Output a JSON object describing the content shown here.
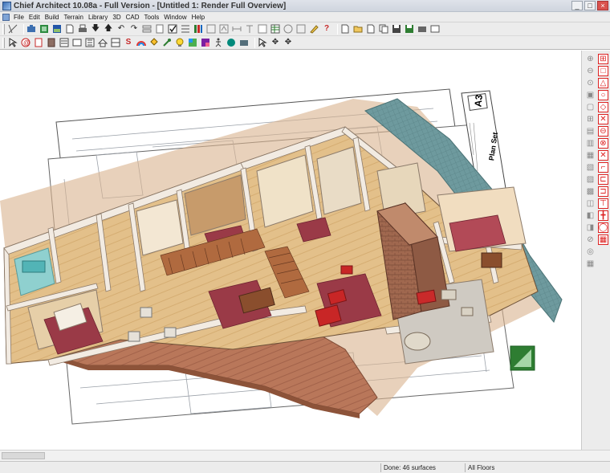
{
  "window": {
    "title": "Chief Architect 10.08a - Full Version - [Untitled 1: Render Full Overview]",
    "controls": [
      "_",
      "□",
      "×"
    ]
  },
  "menubar": {
    "items": [
      "File",
      "Edit",
      "Build",
      "Terrain",
      "Library",
      "3D",
      "CAD",
      "Tools",
      "Window",
      "Help"
    ]
  },
  "toolbar1": {
    "icons": [
      "select-objects",
      "camera",
      "full-overview",
      "render",
      "new-file",
      "print",
      "arrow-down",
      "arrow-up",
      "undo",
      "redo",
      "layer",
      "bookmark",
      "checkbox",
      "list",
      "library",
      "library-2",
      "library-3",
      "dimension",
      "text",
      "text-2",
      "schedule",
      "materials",
      "settings",
      "paint",
      "help",
      "new",
      "open",
      "new-plan",
      "copy",
      "save",
      "save-as",
      "export",
      "print-preview"
    ]
  },
  "toolbar2": {
    "icons": [
      "pointer",
      "cabinet",
      "door",
      "window",
      "stairs",
      "walls",
      "fixture",
      "roof",
      "room",
      "text-tool",
      "rainbow",
      "paint-bucket",
      "eyedropper",
      "light",
      "material",
      "texture",
      "walk",
      "camera-3d",
      "render-tool",
      "move",
      "rotate",
      "transform"
    ]
  },
  "right_toolbar": {
    "column1": [
      "zoom-in",
      "zoom-out",
      "zoom-fit",
      "view-a",
      "view-b",
      "view-c",
      "view-d",
      "view-e",
      "view-f",
      "view-g",
      "view-h",
      "view-i",
      "view-j",
      "view-k",
      "view-l",
      "view-m",
      "view-n",
      "view-o"
    ],
    "column2": [
      "grid",
      "square",
      "triangle",
      "circle",
      "diamond",
      "x-box",
      "minus-box",
      "x-box-2",
      "arc",
      "corner",
      "door-box",
      "window-box",
      "line-tool",
      "cross",
      "ellipse",
      "grid-2"
    ]
  },
  "status": {
    "done": "Done: 46 surfaces",
    "floors": "All Floors"
  },
  "plan": {
    "sheet_code": "A3",
    "sheet_title": "Plan Set",
    "accent_colors": {
      "wood": "#b9775a",
      "tile": "#6e9a9e",
      "walls": "#f2ebe2",
      "rug": "#9a3a47",
      "sofa": "#c82626"
    }
  }
}
